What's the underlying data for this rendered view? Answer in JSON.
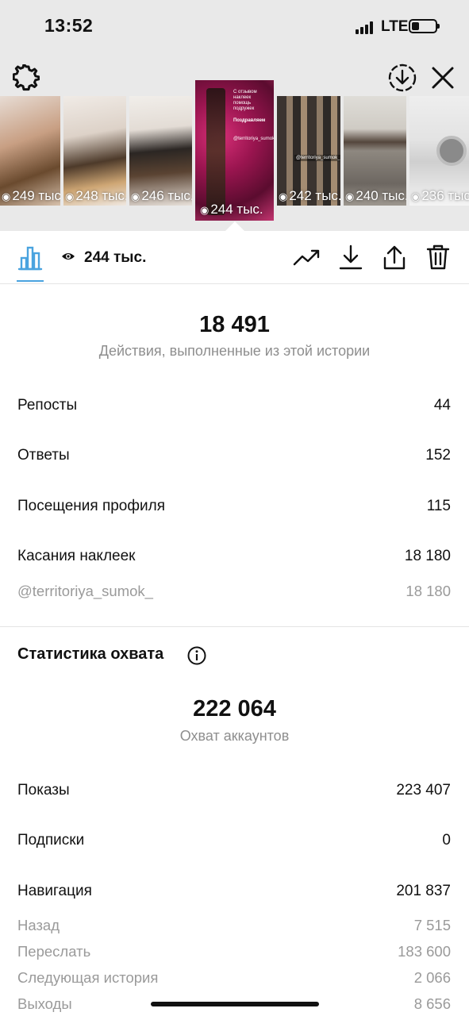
{
  "status_bar": {
    "time": "13:52",
    "network": "LTE"
  },
  "thumbnails": [
    {
      "views": "249 тыс.",
      "selected": false
    },
    {
      "views": "248 тыс.",
      "selected": false
    },
    {
      "views": "246 тыс.",
      "selected": false
    },
    {
      "views": "244 тыс.",
      "selected": true,
      "text_lines": [
        "С отзывом наклеек",
        "помощь подружек",
        "Поздравляем",
        "@territoriya_sumok_"
      ]
    },
    {
      "views": "242 тыс.",
      "selected": false,
      "text_lines": [
        "@territoriya_sumok_"
      ]
    },
    {
      "views": "240 тыс.",
      "selected": false
    },
    {
      "views": "236 тыс.",
      "selected": false
    }
  ],
  "action_bar": {
    "views": "244 тыс."
  },
  "interactions": {
    "total": "18 491",
    "total_label": "Действия, выполненные из этой истории",
    "rows": [
      {
        "label": "Репосты",
        "value": "44"
      },
      {
        "label": "Ответы",
        "value": "152"
      },
      {
        "label": "Посещения профиля",
        "value": "115"
      },
      {
        "label": "Касания наклеек",
        "value": "18 180"
      }
    ],
    "sticker": {
      "label": "@territoriya_sumok_",
      "value": "18 180"
    }
  },
  "reach": {
    "title": "Статистика охвата",
    "total": "222 064",
    "total_label": "Охват аккаунтов",
    "rows": [
      {
        "label": "Показы",
        "value": "223 407"
      },
      {
        "label": "Подписки",
        "value": "0"
      },
      {
        "label": "Навигация",
        "value": "201 837"
      }
    ],
    "nav_rows": [
      {
        "label": "Назад",
        "value": "7 515"
      },
      {
        "label": "Переслать",
        "value": "183 600"
      },
      {
        "label": "Следующая история",
        "value": "2 066"
      },
      {
        "label": "Выходы",
        "value": "8 656"
      }
    ]
  },
  "colors": {
    "accent": "#4aa3df",
    "muted": "#8e8e8e",
    "text": "#111111",
    "top_bg": "#e9e9e9"
  }
}
